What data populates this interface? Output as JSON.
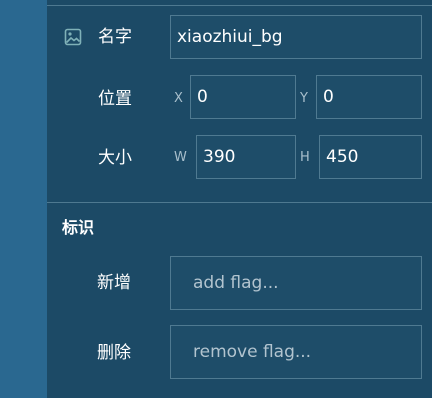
{
  "properties": {
    "name": {
      "label": "名字",
      "value": "xiaozhiui_bg"
    },
    "position": {
      "label": "位置",
      "x_axis": "X",
      "x_value": "0",
      "y_axis": "Y",
      "y_value": "0"
    },
    "size": {
      "label": "大小",
      "w_axis": "W",
      "w_value": "390",
      "h_axis": "H",
      "h_value": "450"
    }
  },
  "flags": {
    "title": "标识",
    "add": {
      "label": "新增",
      "placeholder": "add flag..."
    },
    "remove": {
      "label": "删除",
      "placeholder": "remove flag..."
    }
  },
  "icons": {
    "name_row": "image-icon"
  },
  "colors": {
    "panel_bg": "#1c4a66",
    "left_strip": "#2a6890",
    "field_border": "#4f7a91",
    "divider": "#4e7990"
  }
}
